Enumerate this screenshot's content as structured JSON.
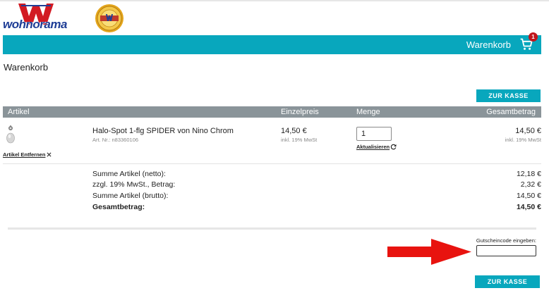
{
  "brand": {
    "logo_text": "wohnorama",
    "logo_letter": "W",
    "seal_text": ""
  },
  "colors": {
    "accent": "#08a7bd",
    "header_gray": "#8a9499",
    "badge": "#c0161c",
    "arrow": "#e8130f",
    "logo_red": "#d21a23",
    "logo_blue": "#1f3e96"
  },
  "cartbar": {
    "label": "Warenkorb",
    "icon": "shopping-cart-icon",
    "badge_count": "1"
  },
  "page_title": "Warenkorb",
  "checkout_label": "ZUR KASSE",
  "table": {
    "headers": [
      "Artikel",
      "Einzelpreis",
      "Menge",
      "Gesamtbetrag"
    ],
    "rows": [
      {
        "name": "Halo-Spot 1-flg SPIDER von Nino Chrom",
        "article_no": "Art. Nr.: n83360106",
        "unit_price": "14,50 €",
        "unit_tax": "inkl. 19% MwSt",
        "quantity": "1",
        "refresh_label": "Aktualisieren",
        "total": "14,50 €",
        "total_tax": "inkl. 19% MwSt",
        "remove_label": "Artikel Entfernen"
      }
    ]
  },
  "summary": [
    {
      "label": "Summe Artikel (netto):",
      "value": "12,18 €"
    },
    {
      "label": "zzgl. 19% MwSt., Betrag:",
      "value": "2,32 €"
    },
    {
      "label": "Summe Artikel (brutto):",
      "value": "14,50 €"
    },
    {
      "label": "Gesamtbetrag:",
      "value": "14,50 €"
    }
  ],
  "voucher": {
    "label": "Gutscheincode eingeben:",
    "value": "",
    "placeholder": ""
  }
}
